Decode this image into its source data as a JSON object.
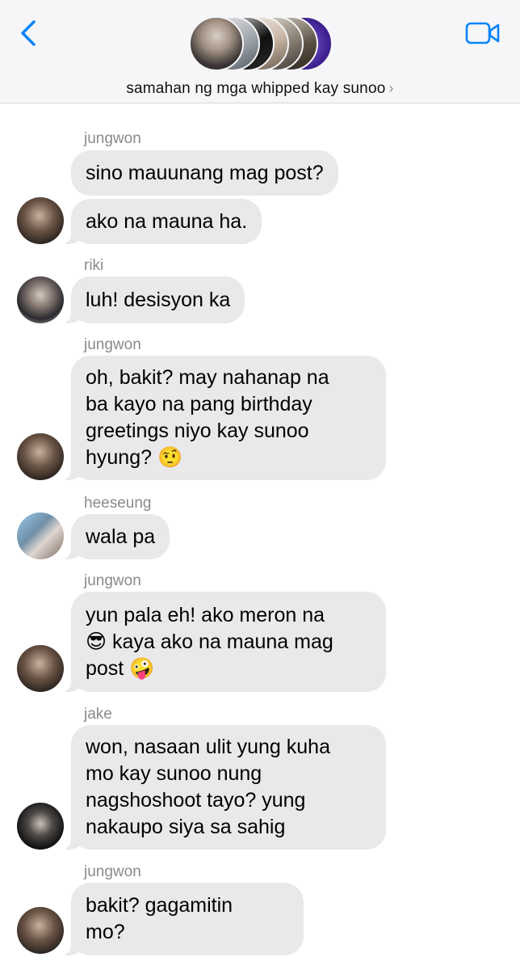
{
  "header": {
    "group_name": "samahan ng mga whipped kay sunoo",
    "chevron": "›",
    "icons": {
      "back": "chevron-left-icon",
      "call": "video-camera-icon"
    },
    "accent": "#0a84ff"
  },
  "messages": [
    {
      "sender": "jungwon",
      "text": "sino mauunang mag post?"
    },
    {
      "sender": "",
      "text": "ako na mauna ha."
    },
    {
      "sender": "riki",
      "text": "luh! desisyon ka"
    },
    {
      "sender": "jungwon",
      "text": "oh, bakit? may nahanap na\nba kayo na pang birthday\ngreetings niyo kay sunoo\nhyung? 🤨"
    },
    {
      "sender": "heeseung",
      "text": "wala pa"
    },
    {
      "sender": "jungwon",
      "text": "yun pala eh! ako meron na\n😎 kaya ako na mauna mag\npost 🤪"
    },
    {
      "sender": "jake",
      "text": "won, nasaan ulit yung kuha\nmo kay sunoo nung\nnagshoshoot tayo? yung\nnakaupo siya sa sahig"
    },
    {
      "sender": "jungwon",
      "text": "bakit? gagamitin\nmo?"
    }
  ],
  "colors": {
    "bubble": "#e9e9eb",
    "header_bg": "#f6f6f8",
    "sender_text": "#8a8a8e"
  }
}
